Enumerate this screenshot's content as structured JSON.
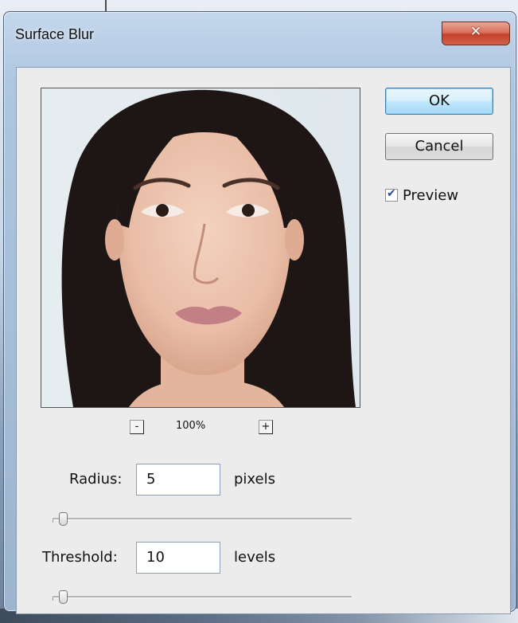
{
  "dialog": {
    "title": "Surface Blur",
    "close_glyph": "✕"
  },
  "preview": {
    "zoom_out_label": "-",
    "zoom_in_label": "+",
    "zoom_level": "100%"
  },
  "buttons": {
    "ok_label": "OK",
    "cancel_label": "Cancel"
  },
  "preview_toggle": {
    "label": "Preview",
    "checked": true
  },
  "radius": {
    "label": "Radius:",
    "value": "5",
    "unit": "pixels",
    "slider_fraction": 0.02
  },
  "threshold": {
    "label": "Threshold:",
    "value": "10",
    "unit": "levels",
    "slider_fraction": 0.02
  },
  "colors": {
    "accent_default_button": "#3c7fb1",
    "close_button": "#c4412a",
    "dialog_background": "#ececec"
  }
}
